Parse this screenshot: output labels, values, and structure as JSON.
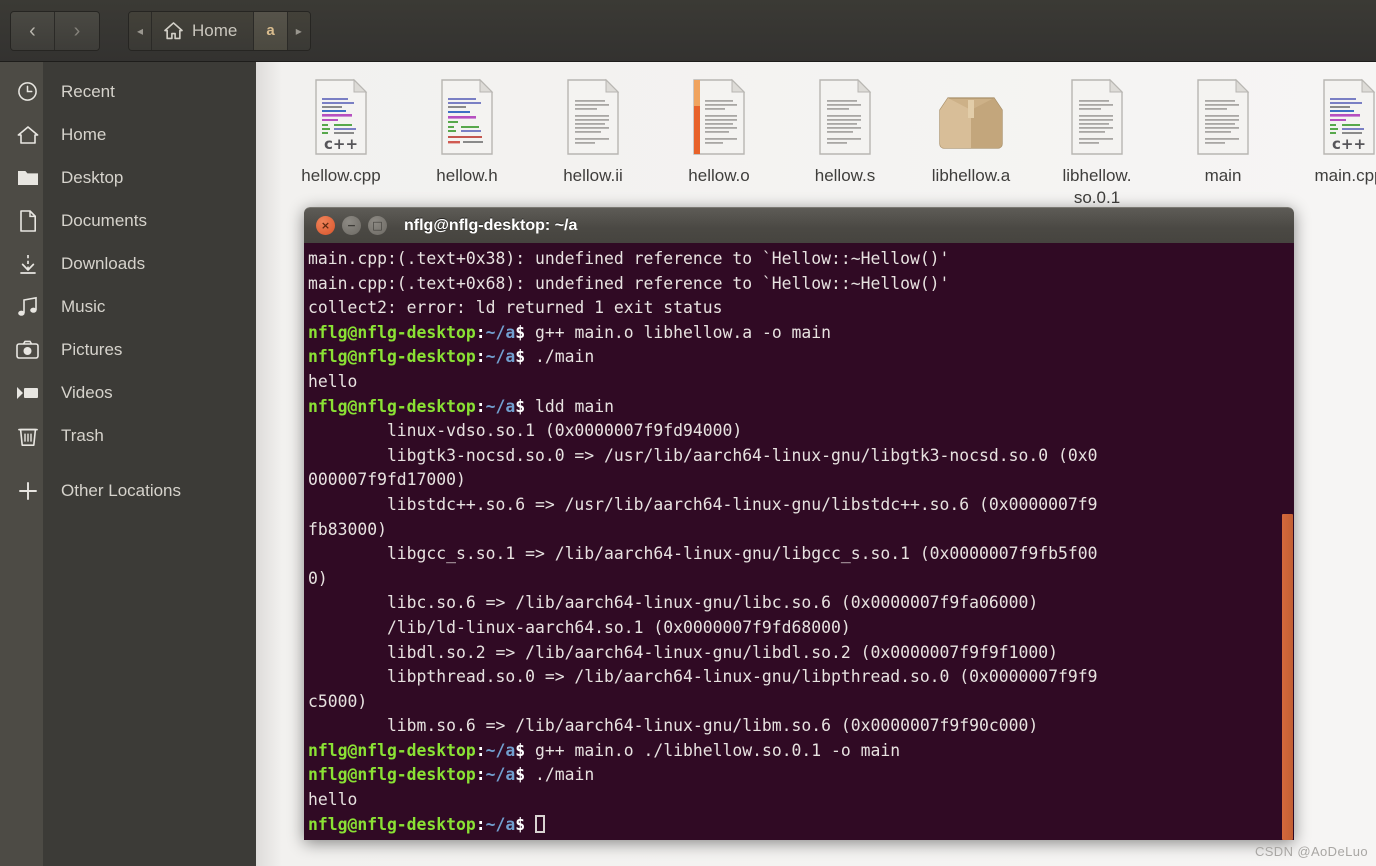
{
  "window": {
    "file_manager_title": "Home"
  },
  "header": {
    "nav": [
      {
        "name": "back",
        "glyph": "‹"
      },
      {
        "name": "forward",
        "glyph": "›"
      }
    ],
    "pathbar": [
      {
        "type": "arrow",
        "label": "◂",
        "active": false,
        "name": "path-scroll-left"
      },
      {
        "type": "home",
        "label": "Home",
        "active": false,
        "name": "path-home"
      },
      {
        "type": "crumb",
        "label": "a",
        "active": true,
        "name": "path-a"
      },
      {
        "type": "arrow",
        "label": "▸",
        "active": false,
        "name": "path-scroll-right"
      }
    ]
  },
  "sidebar": {
    "items": [
      {
        "label": "Recent",
        "icon": "clock-icon"
      },
      {
        "label": "Home",
        "icon": "home-icon"
      },
      {
        "label": "Desktop",
        "icon": "folder-icon"
      },
      {
        "label": "Documents",
        "icon": "document-icon"
      },
      {
        "label": "Downloads",
        "icon": "download-icon"
      },
      {
        "label": "Music",
        "icon": "music-icon"
      },
      {
        "label": "Pictures",
        "icon": "camera-icon"
      },
      {
        "label": "Videos",
        "icon": "video-icon"
      },
      {
        "label": "Trash",
        "icon": "trash-icon"
      },
      {
        "label": "Other Locations",
        "icon": "plus-icon"
      }
    ]
  },
  "files": [
    {
      "name": "hellow.cpp",
      "icon": "cpp-source-file-icon",
      "badge": "c++"
    },
    {
      "name": "hellow.h",
      "icon": "c-header-file-icon",
      "badge": ""
    },
    {
      "name": "hellow.ii",
      "icon": "text-file-icon",
      "badge": ""
    },
    {
      "name": "hellow.o",
      "icon": "object-file-icon",
      "badge": ""
    },
    {
      "name": "hellow.s",
      "icon": "assembly-file-icon",
      "badge": ""
    },
    {
      "name": "libhellow.a",
      "icon": "archive-package-icon",
      "badge": ""
    },
    {
      "name": "libhellow.\nso.0.1",
      "icon": "shared-library-file-icon",
      "badge": ""
    },
    {
      "name": "main",
      "icon": "executable-file-icon",
      "badge": ""
    },
    {
      "name": "main.cpp",
      "icon": "cpp-source-file-icon",
      "badge": "c++"
    }
  ],
  "terminal": {
    "title": "nflg@nflg-desktop: ~/a",
    "buttons": {
      "close": "×",
      "minimize": "−",
      "maximize": "□"
    },
    "prompt": {
      "user_host": "nflg@nflg-desktop",
      "sep": ":",
      "path": "~/a",
      "dollar": "$"
    },
    "lines": [
      {
        "type": "out",
        "text": "main.cpp:(.text+0x38): undefined reference to `Hellow::~Hellow()'"
      },
      {
        "type": "out",
        "text": "main.cpp:(.text+0x68): undefined reference to `Hellow::~Hellow()'"
      },
      {
        "type": "out",
        "text": "collect2: error: ld returned 1 exit status"
      },
      {
        "type": "cmd",
        "text": " g++ main.o libhellow.a -o main"
      },
      {
        "type": "cmd",
        "text": " ./main"
      },
      {
        "type": "out",
        "text": "hello"
      },
      {
        "type": "cmd",
        "text": " ldd main"
      },
      {
        "type": "out",
        "text": "        linux-vdso.so.1 (0x0000007f9fd94000)"
      },
      {
        "type": "out",
        "text": "        libgtk3-nocsd.so.0 => /usr/lib/aarch64-linux-gnu/libgtk3-nocsd.so.0 (0x0"
      },
      {
        "type": "out",
        "text": "000007f9fd17000)"
      },
      {
        "type": "out",
        "text": "        libstdc++.so.6 => /usr/lib/aarch64-linux-gnu/libstdc++.so.6 (0x0000007f9"
      },
      {
        "type": "out",
        "text": "fb83000)"
      },
      {
        "type": "out",
        "text": "        libgcc_s.so.1 => /lib/aarch64-linux-gnu/libgcc_s.so.1 (0x0000007f9fb5f00"
      },
      {
        "type": "out",
        "text": "0)"
      },
      {
        "type": "out",
        "text": "        libc.so.6 => /lib/aarch64-linux-gnu/libc.so.6 (0x0000007f9fa06000)"
      },
      {
        "type": "out",
        "text": "        /lib/ld-linux-aarch64.so.1 (0x0000007f9fd68000)"
      },
      {
        "type": "out",
        "text": "        libdl.so.2 => /lib/aarch64-linux-gnu/libdl.so.2 (0x0000007f9f9f1000)"
      },
      {
        "type": "out",
        "text": "        libpthread.so.0 => /lib/aarch64-linux-gnu/libpthread.so.0 (0x0000007f9f9"
      },
      {
        "type": "out",
        "text": "c5000)"
      },
      {
        "type": "out",
        "text": "        libm.so.6 => /lib/aarch64-linux-gnu/libm.so.6 (0x0000007f9f90c000)"
      },
      {
        "type": "cmd",
        "text": " g++ main.o ./libhellow.so.0.1 -o main"
      },
      {
        "type": "cmd",
        "text": " ./main"
      },
      {
        "type": "out",
        "text": "hello"
      },
      {
        "type": "cursor",
        "text": " "
      }
    ]
  },
  "watermark": {
    "text": "CSDN @AoDeLuo"
  },
  "colors": {
    "terminal_bg": "#300a24",
    "prompt_green": "#8ae234",
    "prompt_blue": "#729fcf",
    "scrollbar_orange": "#c9603a",
    "breadcrumb_active_text": "#d9bc8e"
  }
}
